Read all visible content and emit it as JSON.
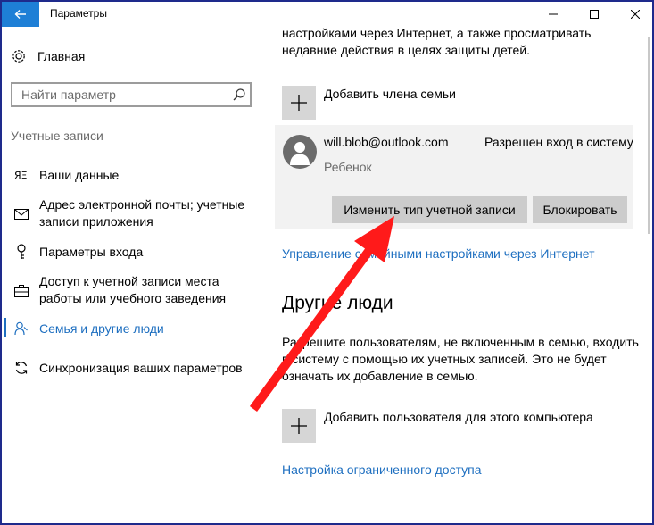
{
  "window": {
    "title": "Параметры",
    "back_icon": "back-arrow-icon",
    "controls": [
      "minimize-icon",
      "maximize-icon",
      "close-icon"
    ]
  },
  "sidebar": {
    "home_label": "Главная",
    "search": {
      "placeholder": "Найти параметр"
    },
    "section_title": "Учетные записи",
    "items": [
      {
        "label": "Ваши данные",
        "icon": "person-card-icon"
      },
      {
        "label": "Адрес электронной почты; учетные записи приложения",
        "icon": "mail-icon"
      },
      {
        "label": "Параметры входа",
        "icon": "key-icon"
      },
      {
        "label": "Доступ к учетной записи места работы или учебного заведения",
        "icon": "briefcase-icon"
      },
      {
        "label": "Семья и другие люди",
        "icon": "people-icon",
        "active": true
      },
      {
        "label": "Синхронизация ваших параметров",
        "icon": "sync-icon"
      }
    ]
  },
  "main": {
    "intro_text": "настройками через Интернет, а также просматривать недавние действия в целях защиты детей.",
    "add_family_label": "Добавить члена семьи",
    "member": {
      "email": "will.blob@outlook.com",
      "role": "Ребенок",
      "status": "Разрешен вход в систему",
      "change_type_button": "Изменить тип учетной записи",
      "block_button": "Блокировать"
    },
    "manage_link": "Управление семейными настройками через Интернет",
    "other_people_heading": "Другие люди",
    "other_people_text": "Разрешите пользователям, не включенным в семью, входить в систему с помощью их учетных записей. Это не будет означать их добавление в семью.",
    "add_user_label": "Добавить пользователя для этого компьютера",
    "restricted_link": "Настройка ограниченного доступа"
  },
  "annotation": {
    "arrow_color": "#ff1a1a"
  },
  "colors": {
    "accent": "#1e6fc0",
    "titlebar_back": "#1e7fd6",
    "frame": "#1e2a8c"
  }
}
